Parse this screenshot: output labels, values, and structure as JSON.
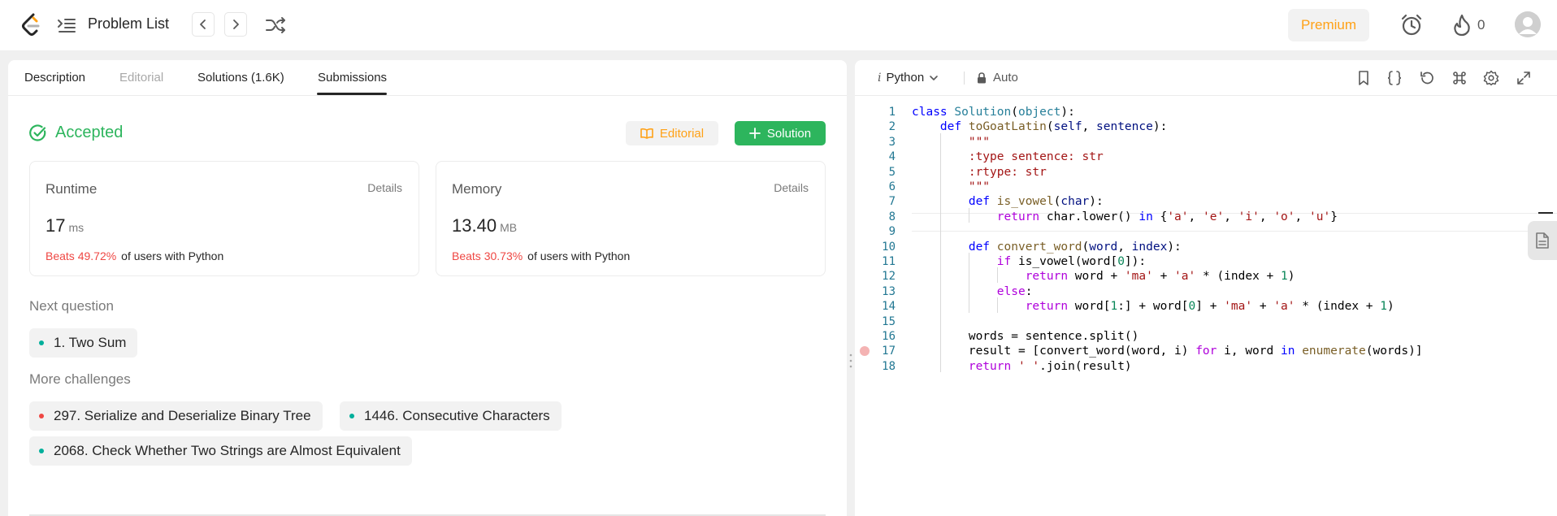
{
  "nav": {
    "title": "Problem List",
    "premium": "Premium",
    "streak": "0"
  },
  "tabs": [
    {
      "label": "Description"
    },
    {
      "label": "Editorial"
    },
    {
      "label": "Solutions (1.6K)"
    },
    {
      "label": "Submissions"
    }
  ],
  "result": {
    "status": "Accepted",
    "editorial_btn": "Editorial",
    "solution_btn": "Solution"
  },
  "runtime": {
    "label": "Runtime",
    "details": "Details",
    "value": "17",
    "unit": "ms",
    "beats": "Beats 49.72%",
    "suffix": "of users with Python"
  },
  "memory": {
    "label": "Memory",
    "details": "Details",
    "value": "13.40",
    "unit": "MB",
    "beats": "Beats 30.73%",
    "suffix": "of users with Python"
  },
  "next_question": {
    "title": "Next question",
    "items": [
      {
        "label": "1. Two Sum",
        "difficulty": "easy"
      }
    ]
  },
  "more_challenges": {
    "title": "More challenges",
    "items": [
      {
        "label": "297. Serialize and Deserialize Binary Tree",
        "difficulty": "hard"
      },
      {
        "label": "1446. Consecutive Characters",
        "difficulty": "easy"
      },
      {
        "label": "2068. Check Whether Two Strings are Almost Equivalent",
        "difficulty": "easy"
      }
    ]
  },
  "editor": {
    "language": "Python",
    "language_glyph": "i",
    "mode": "Auto",
    "breakpoint_line": 17,
    "lines": [
      [
        [
          "kw",
          "class"
        ],
        [
          "",
          " "
        ],
        [
          "cls",
          "Solution"
        ],
        [
          "",
          "("
        ],
        [
          "cls",
          "object"
        ],
        [
          "",
          "):"
        ]
      ],
      [
        [
          "",
          "    "
        ],
        [
          "kw",
          "def"
        ],
        [
          "",
          " "
        ],
        [
          "fn",
          "toGoatLatin"
        ],
        [
          "",
          "("
        ],
        [
          "prm",
          "self"
        ],
        [
          "",
          ", "
        ],
        [
          "prm",
          "sentence"
        ],
        [
          "",
          "):"
        ]
      ],
      [
        [
          "",
          "        "
        ],
        [
          "str",
          "\"\"\""
        ]
      ],
      [
        [
          "",
          "        "
        ],
        [
          "str",
          ":type sentence: str"
        ]
      ],
      [
        [
          "",
          "        "
        ],
        [
          "str",
          ":rtype: str"
        ]
      ],
      [
        [
          "",
          "        "
        ],
        [
          "str",
          "\"\"\""
        ]
      ],
      [
        [
          "",
          "        "
        ],
        [
          "kw",
          "def"
        ],
        [
          "",
          " "
        ],
        [
          "fn",
          "is_vowel"
        ],
        [
          "",
          "("
        ],
        [
          "prm",
          "char"
        ],
        [
          "",
          "):"
        ]
      ],
      [
        [
          "",
          "            "
        ],
        [
          "kw2",
          "return"
        ],
        [
          "",
          " char.lower() "
        ],
        [
          "kw",
          "in"
        ],
        [
          "",
          " {"
        ],
        [
          "str",
          "'a'"
        ],
        [
          "",
          ", "
        ],
        [
          "str",
          "'e'"
        ],
        [
          "",
          ", "
        ],
        [
          "str",
          "'i'"
        ],
        [
          "",
          ", "
        ],
        [
          "str",
          "'o'"
        ],
        [
          "",
          ", "
        ],
        [
          "str",
          "'u'"
        ],
        [
          "",
          "}"
        ]
      ],
      [
        [
          "",
          ""
        ]
      ],
      [
        [
          "",
          "        "
        ],
        [
          "kw",
          "def"
        ],
        [
          "",
          " "
        ],
        [
          "fn",
          "convert_word"
        ],
        [
          "",
          "("
        ],
        [
          "prm",
          "word"
        ],
        [
          "",
          ", "
        ],
        [
          "prm",
          "index"
        ],
        [
          "",
          "):"
        ]
      ],
      [
        [
          "",
          "            "
        ],
        [
          "kw2",
          "if"
        ],
        [
          "",
          " is_vowel(word["
        ],
        [
          "num",
          "0"
        ],
        [
          "",
          "]):"
        ]
      ],
      [
        [
          "",
          "                "
        ],
        [
          "kw2",
          "return"
        ],
        [
          "",
          " word + "
        ],
        [
          "str",
          "'ma'"
        ],
        [
          "",
          " + "
        ],
        [
          "str",
          "'a'"
        ],
        [
          "",
          " * (index + "
        ],
        [
          "num",
          "1"
        ],
        [
          "",
          ")"
        ]
      ],
      [
        [
          "",
          "            "
        ],
        [
          "kw2",
          "else"
        ],
        [
          "",
          ":"
        ]
      ],
      [
        [
          "",
          "                "
        ],
        [
          "kw2",
          "return"
        ],
        [
          "",
          " word["
        ],
        [
          "num",
          "1"
        ],
        [
          "",
          ":] + word["
        ],
        [
          "num",
          "0"
        ],
        [
          "",
          "] + "
        ],
        [
          "str",
          "'ma'"
        ],
        [
          "",
          " + "
        ],
        [
          "str",
          "'a'"
        ],
        [
          "",
          " * (index + "
        ],
        [
          "num",
          "1"
        ],
        [
          "",
          ")"
        ]
      ],
      [
        [
          "",
          ""
        ]
      ],
      [
        [
          "",
          "        words = sentence.split()"
        ]
      ],
      [
        [
          "",
          "        result = [convert_word(word, i) "
        ],
        [
          "kw2",
          "for"
        ],
        [
          "",
          " i, word "
        ],
        [
          "kw",
          "in"
        ],
        [
          "",
          " "
        ],
        [
          "bi",
          "enumerate"
        ],
        [
          "",
          "(words)]"
        ]
      ],
      [
        [
          "",
          "        "
        ],
        [
          "kw2",
          "return"
        ],
        [
          "",
          " "
        ],
        [
          "str",
          "' '"
        ],
        [
          "",
          ".join(result)"
        ]
      ]
    ]
  }
}
